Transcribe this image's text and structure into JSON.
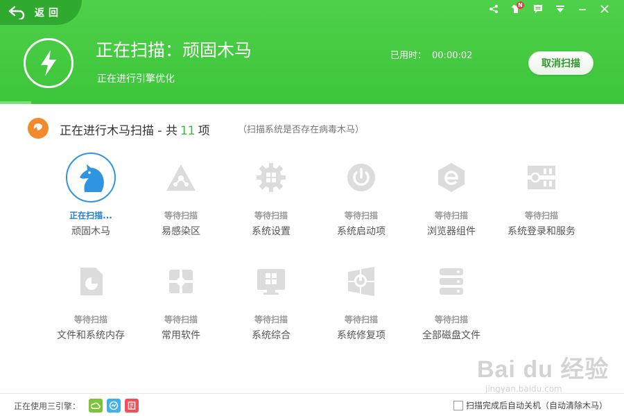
{
  "header": {
    "back_label": "返回",
    "scan_title": "正在扫描：顽固木马",
    "scan_subtitle": "正在进行引擎优化",
    "elapsed_label": "已用时：",
    "elapsed_time": "00:00:02",
    "cancel_label": "取消扫描",
    "badge": "N",
    "progress": 0.05
  },
  "section": {
    "prefix": "正在进行木马扫描 - 共",
    "count": "11",
    "suffix": "项",
    "hint": "（扫描系统是否存在病毒木马）"
  },
  "items": [
    {
      "status": "正在扫描...",
      "name": "顽固木马",
      "icon": "horse-icon",
      "active": true
    },
    {
      "status": "等待扫描",
      "name": "易感染区",
      "icon": "warning-triangle-icon",
      "active": false
    },
    {
      "status": "等待扫描",
      "name": "系统设置",
      "icon": "gear-windows-icon",
      "active": false
    },
    {
      "status": "等待扫描",
      "name": "系统启动项",
      "icon": "power-icon",
      "active": false
    },
    {
      "status": "等待扫描",
      "name": "浏览器组件",
      "icon": "browser-e-icon",
      "active": false
    },
    {
      "status": "等待扫描",
      "name": "系统登录和服务",
      "icon": "login-service-icon",
      "active": false
    },
    {
      "status": "等待扫描",
      "name": "文件和系统内存",
      "icon": "file-pie-icon",
      "active": false
    },
    {
      "status": "等待扫描",
      "name": "常用软件",
      "icon": "puzzle-icon",
      "active": false
    },
    {
      "status": "等待扫描",
      "name": "系统综合",
      "icon": "monitor-windows-icon",
      "active": false
    },
    {
      "status": "等待扫描",
      "name": "系统修复项",
      "icon": "repair-windows-icon",
      "active": false
    },
    {
      "status": "等待扫描",
      "name": "全部磁盘文件",
      "icon": "disk-stack-icon",
      "active": false
    }
  ],
  "footer": {
    "engine_label": "正在使用三引擎：",
    "engines": [
      {
        "icon": "cloud-engine-icon",
        "color": "#7cc53a"
      },
      {
        "icon": "qvm-engine-icon",
        "color": "#3fb0e8"
      },
      {
        "icon": "bitdefender-engine-icon",
        "color": "#f0505a"
      }
    ],
    "auto_shutdown_label": "扫描完成后自动关机（自动清除木马）"
  },
  "watermark": {
    "main": "Bai du 经验",
    "url": "jingyan.baidu.com"
  },
  "colors": {
    "header_green": "#3cc53a",
    "active_blue": "#1e7fd4",
    "accent_orange": "#f08a2c",
    "count_green": "#3cb83a"
  }
}
